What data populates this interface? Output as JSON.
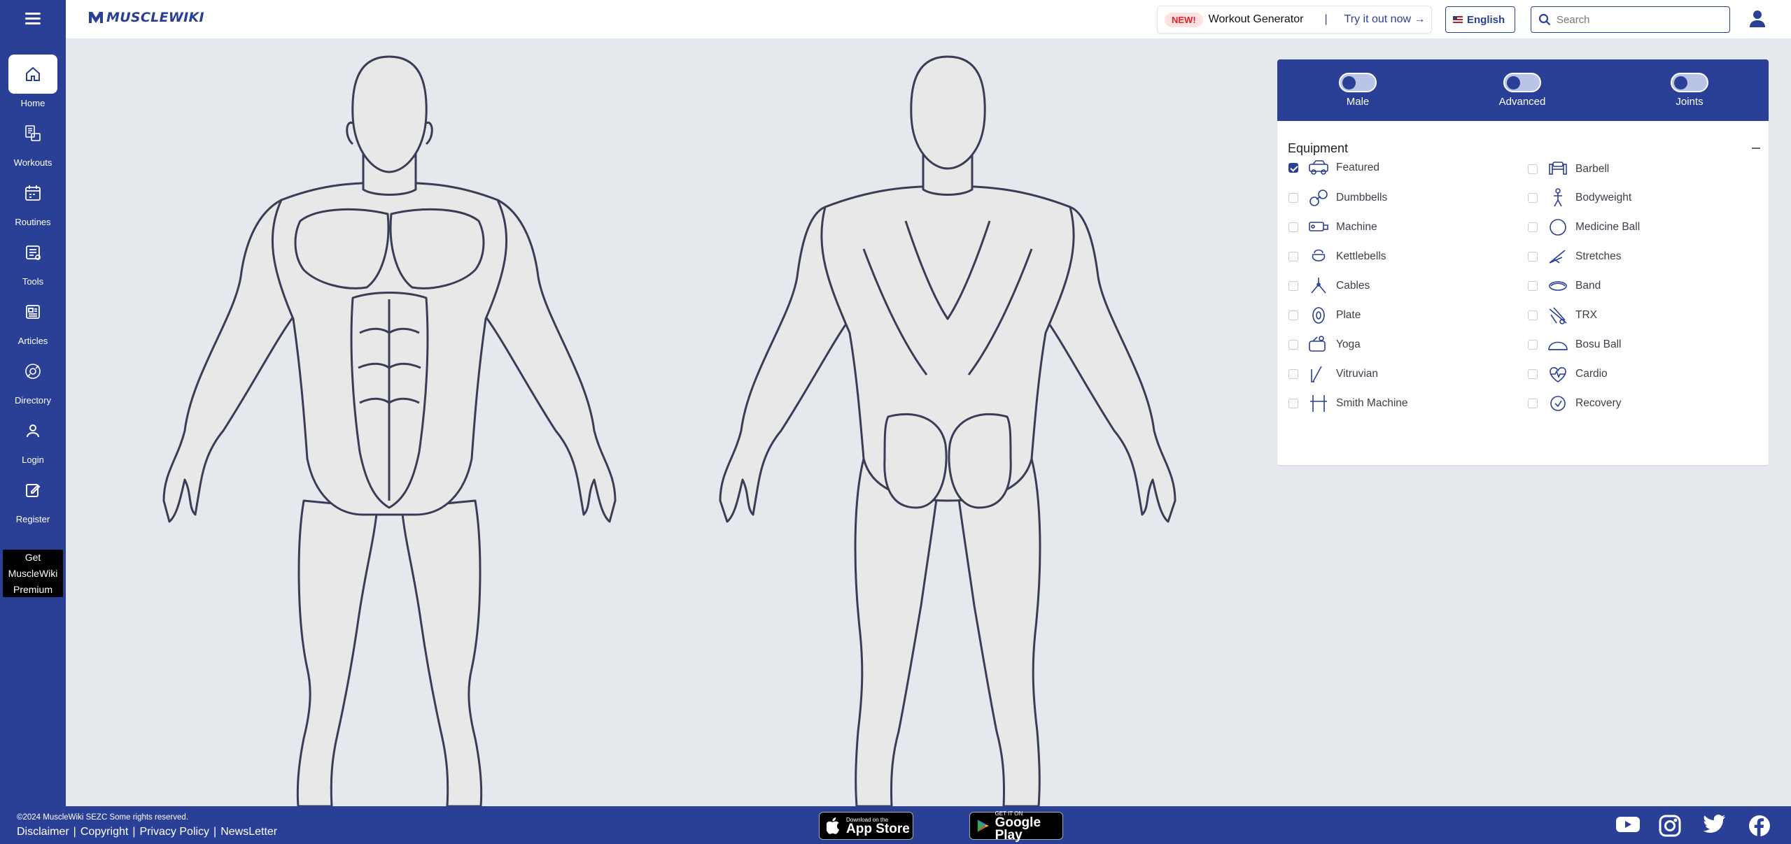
{
  "brand": {
    "name": "MUSCLEWIKI"
  },
  "sidebar": {
    "items": [
      {
        "label": "Home",
        "icon": "home-icon"
      },
      {
        "label": "Workouts",
        "icon": "workouts-icon"
      },
      {
        "label": "Routines",
        "icon": "calendar-icon"
      },
      {
        "label": "Tools",
        "icon": "tools-icon"
      },
      {
        "label": "Articles",
        "icon": "articles-icon"
      },
      {
        "label": "Directory",
        "icon": "directory-icon"
      },
      {
        "label": "Login",
        "icon": "user-icon"
      },
      {
        "label": "Register",
        "icon": "edit-icon"
      }
    ],
    "premium_line1": "Get",
    "premium_line2": "MuscleWiki",
    "premium_line3": "Premium"
  },
  "header": {
    "promo_badge": "NEW!",
    "promo_title": "Workout Generator",
    "promo_sep": "|",
    "promo_link": "Try it out now",
    "language": "English",
    "search_placeholder": "Search"
  },
  "toggles": [
    {
      "label": "Male",
      "on": false
    },
    {
      "label": "Advanced",
      "on": false
    },
    {
      "label": "Joints",
      "on": false
    }
  ],
  "equipment": {
    "title": "Equipment",
    "left": [
      {
        "label": "Featured",
        "checked": true
      },
      {
        "label": "Dumbbells",
        "checked": false
      },
      {
        "label": "Machine",
        "checked": false
      },
      {
        "label": "Kettlebells",
        "checked": false
      },
      {
        "label": "Cables",
        "checked": false
      },
      {
        "label": "Plate",
        "checked": false
      },
      {
        "label": "Yoga",
        "checked": false
      },
      {
        "label": "Vitruvian",
        "checked": false
      },
      {
        "label": "Smith Machine",
        "checked": false
      }
    ],
    "right": [
      {
        "label": "Barbell",
        "checked": false
      },
      {
        "label": "Bodyweight",
        "checked": false
      },
      {
        "label": "Medicine Ball",
        "checked": false
      },
      {
        "label": "Stretches",
        "checked": false
      },
      {
        "label": "Band",
        "checked": false
      },
      {
        "label": "TRX",
        "checked": false
      },
      {
        "label": "Bosu Ball",
        "checked": false
      },
      {
        "label": "Cardio",
        "checked": false
      },
      {
        "label": "Recovery",
        "checked": false
      }
    ]
  },
  "footer": {
    "copyright": "©2024 MuscleWiki SEZC Some rights reserved.",
    "links": [
      "Disclaimer",
      "Copyright",
      "Privacy Policy",
      "NewsLetter"
    ],
    "sep": "|",
    "appstore_small": "Download on the",
    "appstore_big": "App Store",
    "googleplay_small": "GET IT ON",
    "googleplay_big": "Google Play"
  },
  "colors": {
    "brand": "#2a3f96",
    "background": "#e5e9ee",
    "badge_red": "#e02424"
  }
}
